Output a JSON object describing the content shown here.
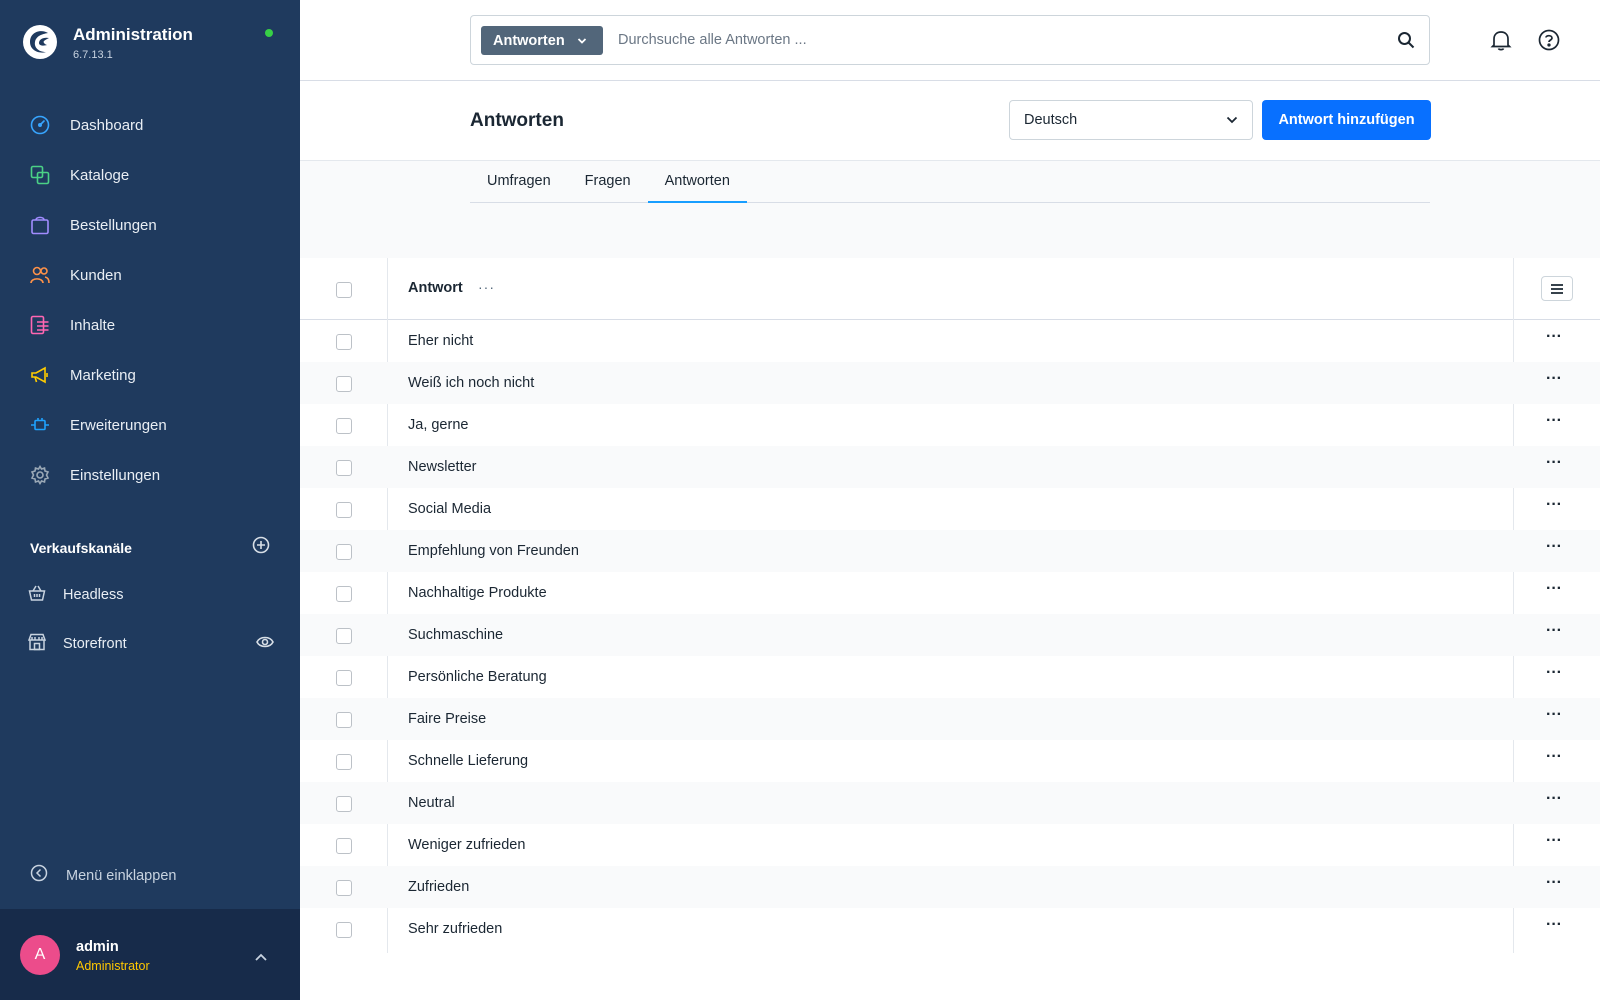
{
  "app": {
    "title": "Administration",
    "version": "6.7.13.1",
    "status_color": "#37d046"
  },
  "nav": [
    {
      "label": "Dashboard",
      "icon": "dashboard-icon",
      "color": "#37a5ff"
    },
    {
      "label": "Kataloge",
      "icon": "catalog-icon",
      "color": "#4bd186"
    },
    {
      "label": "Bestellungen",
      "icon": "orders-bag-icon",
      "color": "#a18cff"
    },
    {
      "label": "Kunden",
      "icon": "customers-icon",
      "color": "#ff9248"
    },
    {
      "label": "Inhalte",
      "icon": "content-icon",
      "color": "#ff66b2"
    },
    {
      "label": "Marketing",
      "icon": "megaphone-icon",
      "color": "#ffcc00"
    },
    {
      "label": "Erweiterungen",
      "icon": "plug-icon",
      "color": "#1ea2ff"
    },
    {
      "label": "Einstellungen",
      "icon": "gear-icon",
      "color": "#9aa8b6"
    }
  ],
  "sales_channels": {
    "title": "Verkaufskanäle",
    "items": [
      {
        "label": "Headless",
        "icon": "basket-icon"
      },
      {
        "label": "Storefront",
        "icon": "storefront-icon"
      }
    ]
  },
  "sidebar_footer": {
    "collapse_label": "Menü einklappen",
    "user_initial": "A",
    "user_name": "admin",
    "user_role": "Administrator"
  },
  "search": {
    "type_label": "Antworten",
    "placeholder": "Durchsuche alle Antworten ..."
  },
  "page": {
    "title": "Antworten",
    "language": "Deutsch",
    "add_button": "Antwort hinzufügen",
    "accent_color": "#0870ff"
  },
  "tabs": [
    {
      "label": "Umfragen",
      "active": false
    },
    {
      "label": "Fragen",
      "active": false
    },
    {
      "label": "Antworten",
      "active": true
    }
  ],
  "grid": {
    "column_header": "Antwort",
    "header_menu": "···",
    "row_actions": "···",
    "rows": [
      "Eher nicht",
      "Weiß ich noch nicht",
      "Ja, gerne",
      "Newsletter",
      "Social Media",
      "Empfehlung von Freunden",
      "Nachhaltige Produkte",
      "Suchmaschine",
      "Persönliche Beratung",
      "Faire Preise",
      "Schnelle Lieferung",
      "Neutral",
      "Weniger zufrieden",
      "Zufrieden",
      "Sehr zufrieden"
    ]
  }
}
